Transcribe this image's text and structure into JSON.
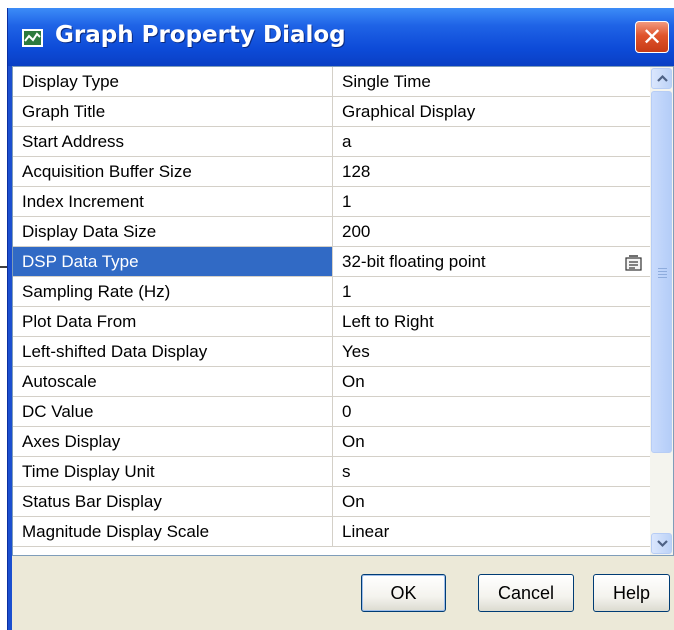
{
  "window": {
    "title": "Graph Property Dialog",
    "close_label": "✕"
  },
  "properties": [
    {
      "name": "Display Type",
      "value": "Single Time"
    },
    {
      "name": "Graph Title",
      "value": "Graphical Display"
    },
    {
      "name": "Start Address",
      "value": "a"
    },
    {
      "name": "Acquisition Buffer Size",
      "value": "128"
    },
    {
      "name": "Index Increment",
      "value": "1"
    },
    {
      "name": "Display Data Size",
      "value": "200"
    },
    {
      "name": "DSP Data Type",
      "value": "32-bit floating point"
    },
    {
      "name": "Sampling Rate (Hz)",
      "value": "1"
    },
    {
      "name": "Plot Data From",
      "value": "Left to Right"
    },
    {
      "name": "Left-shifted Data Display",
      "value": "Yes"
    },
    {
      "name": "Autoscale",
      "value": "On"
    },
    {
      "name": "DC Value",
      "value": "0"
    },
    {
      "name": "Axes Display",
      "value": "On"
    },
    {
      "name": "Time Display Unit",
      "value": "s"
    },
    {
      "name": "Status Bar Display",
      "value": "On"
    },
    {
      "name": "Magnitude Display Scale",
      "value": "Linear"
    }
  ],
  "selected_property": "DSP Data Type",
  "buttons": {
    "ok": "OK",
    "cancel": "Cancel",
    "help": "Help"
  },
  "icons": {
    "app": "graph-app-icon",
    "close": "close-icon",
    "dropdown": "dropdown-list-icon",
    "scroll_up": "chevron-up-icon",
    "scroll_down": "chevron-down-icon"
  },
  "colors": {
    "titlebar": "#0d4bd8",
    "selection": "#316ac5",
    "close_button": "#e0542c",
    "dialog_face": "#ece9d8"
  }
}
